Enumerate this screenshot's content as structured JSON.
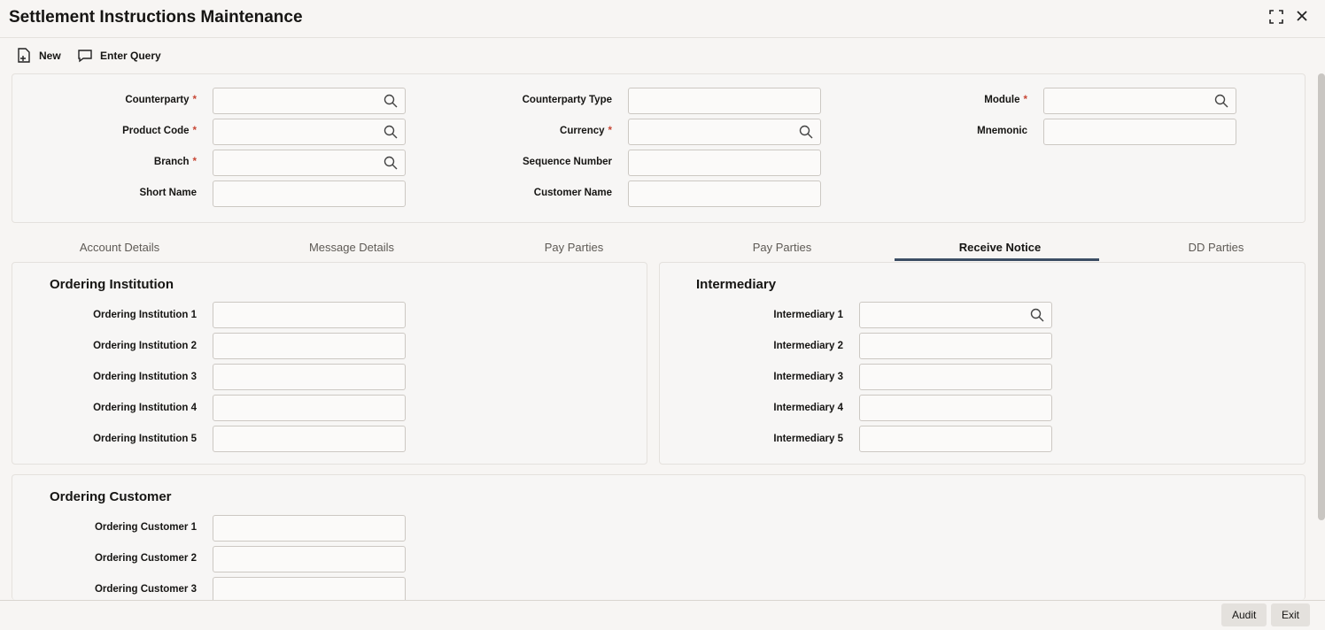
{
  "window": {
    "title": "Settlement Instructions Maintenance"
  },
  "toolbar": {
    "new_label": "New",
    "enter_query_label": "Enter Query"
  },
  "header_fields": {
    "counterparty": "Counterparty",
    "counterparty_type": "Counterparty Type",
    "module": "Module",
    "product_code": "Product Code",
    "currency": "Currency",
    "mnemonic": "Mnemonic",
    "branch": "Branch",
    "sequence_number": "Sequence Number",
    "short_name": "Short Name",
    "customer_name": "Customer Name",
    "required_marker": "*"
  },
  "tabs": [
    "Account Details",
    "Message Details",
    "Pay Parties",
    "Pay Parties",
    "Receive Notice",
    "DD Parties"
  ],
  "active_tab": "Receive Notice",
  "ordering_institution": {
    "title": "Ordering Institution",
    "fields": [
      "Ordering Institution 1",
      "Ordering Institution 2",
      "Ordering Institution 3",
      "Ordering Institution 4",
      "Ordering Institution 5"
    ]
  },
  "intermediary": {
    "title": "Intermediary",
    "fields": [
      "Intermediary 1",
      "Intermediary 2",
      "Intermediary 3",
      "Intermediary 4",
      "Intermediary 5"
    ]
  },
  "ordering_customer": {
    "title": "Ordering Customer",
    "fields": [
      "Ordering Customer 1",
      "Ordering Customer 2",
      "Ordering Customer 3"
    ]
  },
  "footer": {
    "audit_label": "Audit",
    "exit_label": "Exit"
  },
  "icons": {
    "new": "new-document-icon",
    "enter_query": "speech-bubble-icon",
    "search": "search-icon",
    "maximize": "maximize-icon",
    "close": "close-icon"
  },
  "colors": {
    "required": "#c74634",
    "active_tab_underline": "#3c4e64"
  }
}
